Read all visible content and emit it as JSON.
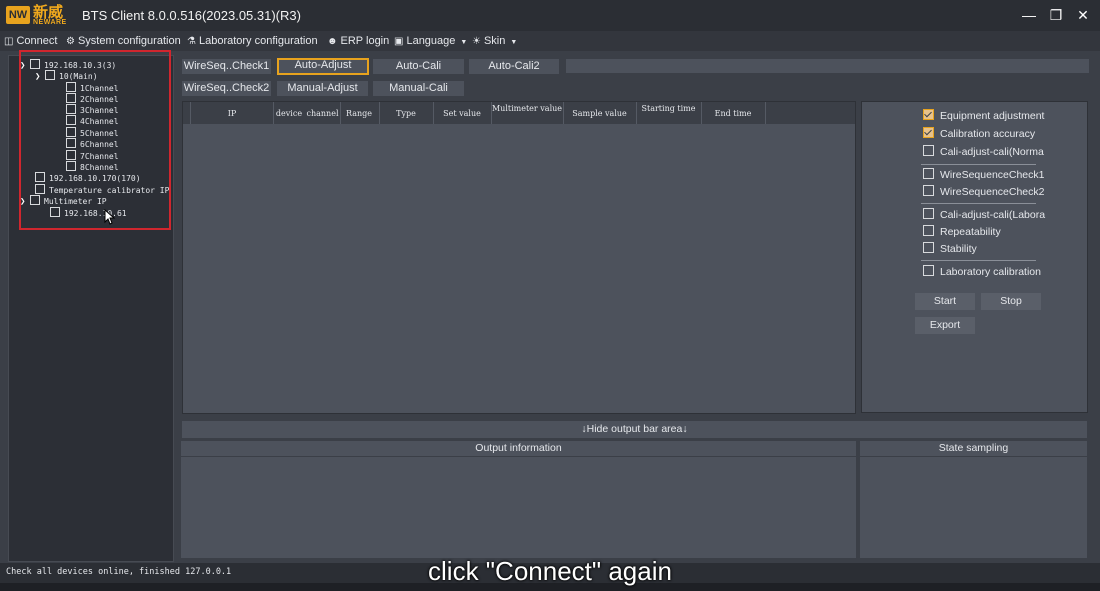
{
  "window": {
    "title": "BTS Client 8.0.0.516(2023.05.31)(R3)",
    "logo_cn": "新威",
    "logo_en": "NEWARE",
    "logo_mark": "NW"
  },
  "menu": {
    "connect": "Connect",
    "system_configuration": "System configuration",
    "laboratory_configuration": "Laboratory configuration",
    "erp_login": "ERP login",
    "language": "Language",
    "skin": "Skin"
  },
  "tree": {
    "device_1": "192.168.10.3(3)",
    "unit_main": "10(Main)",
    "channels": [
      "1Channel",
      "2Channel",
      "3Channel",
      "4Channel",
      "5Channel",
      "6Channel",
      "7Channel",
      "8Channel"
    ],
    "device_2": "192.168.10.170(170)",
    "temp_calibrator": "Temperature calibrator IP",
    "multimeter": "Multimeter IP",
    "multimeter_ip": "192.168.10.61"
  },
  "tabs": {
    "row1": [
      "WireSeq..Check1",
      "Auto-Adjust",
      "Auto-Cali",
      "Auto-Cali2"
    ],
    "row2": [
      "WireSeq..Check2",
      "Manual-Adjust",
      "Manual-Cali"
    ],
    "active": "Auto-Adjust"
  },
  "grid": {
    "columns": [
      "IP",
      "device",
      "channel",
      "Range",
      "Type",
      "Set value",
      "Multimeter value",
      "Sample value",
      "Starting time",
      "End time"
    ]
  },
  "options": {
    "equipment_adjustment": "Equipment adjustment",
    "calibration_accuracy": "Calibration accuracy",
    "cali_adjust_normal": "Cali-adjust-cali(Norma",
    "wire_check1": "WireSequenceCheck1",
    "wire_check2": "WireSequenceCheck2",
    "cali_adjust_labora": "Cali-adjust-cali(Labora",
    "repeatability": "Repeatability",
    "stability": "Stability",
    "laboratory_calibration": "Laboratory calibration",
    "checked": [
      "Equipment adjustment",
      "Calibration accuracy"
    ]
  },
  "actions": {
    "start": "Start",
    "stop": "Stop",
    "export": "Export"
  },
  "output": {
    "hide_bar": "↓Hide output bar area↓",
    "output_information": "Output information",
    "state_sampling": "State sampling"
  },
  "status": {
    "text": "Check all devices online, finished 127.0.0.1"
  },
  "caption": "click \"Connect\" again",
  "colors": {
    "accent": "#e8a31e",
    "highlight_box": "#d0262e",
    "background": "#3b3f47",
    "panel": "#4d525c"
  }
}
